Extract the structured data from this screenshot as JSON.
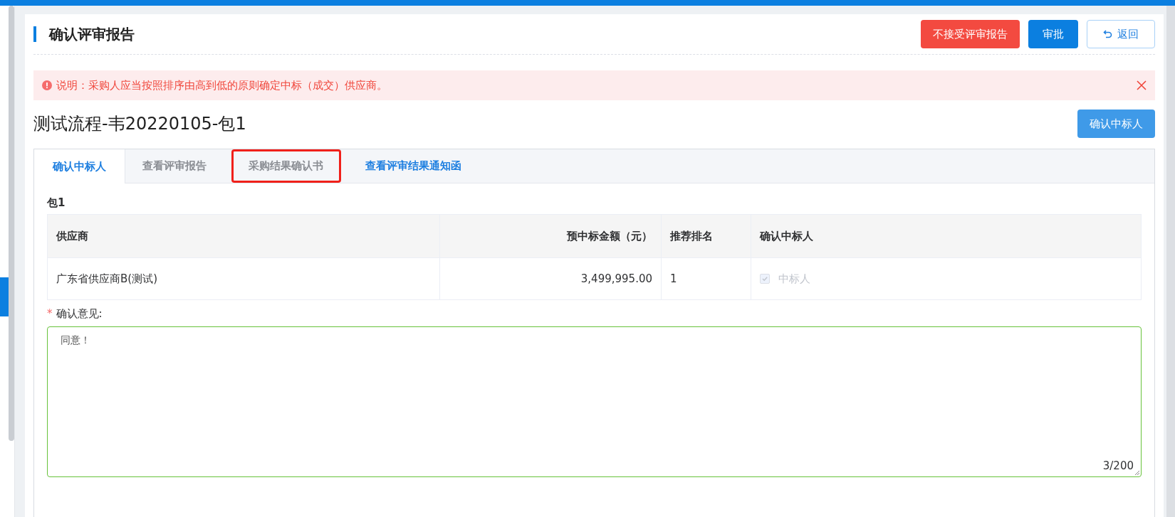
{
  "page_title": "确认评审报告",
  "header_buttons": [
    {
      "label": "不接受评审报告",
      "kind": "danger"
    },
    {
      "label": "审批",
      "kind": "primary"
    },
    {
      "label": "返回",
      "kind": "back"
    }
  ],
  "alert": {
    "text": "说明：采购人应当按照排序由高到低的原则确定中标（成交）供应商。"
  },
  "project_title": "测试流程-韦20220105-包1",
  "confirm_button": "确认中标人",
  "tabs": [
    {
      "label": "确认中标人",
      "selected": true,
      "highlighted": false,
      "annotated": false
    },
    {
      "label": "查看评审报告",
      "selected": false,
      "highlighted": false,
      "annotated": false
    },
    {
      "label": "采购结果确认书",
      "selected": false,
      "highlighted": false,
      "annotated": true
    },
    {
      "label": "查看评审结果通知函",
      "selected": false,
      "highlighted": true,
      "annotated": false
    }
  ],
  "package_label": "包1",
  "table": {
    "columns": [
      "供应商",
      "预中标金额（元）",
      "推荐排名",
      "确认中标人"
    ],
    "rows": [
      {
        "supplier": "广东省供应商B(测试)",
        "amount": "3,499,995.00",
        "rank": "1",
        "winner_label": "中标人",
        "checked": true,
        "disabled": true
      }
    ]
  },
  "opinion": {
    "label": "确认意见:",
    "required_mark": "*",
    "value": "同意！",
    "counter": "3/200"
  }
}
